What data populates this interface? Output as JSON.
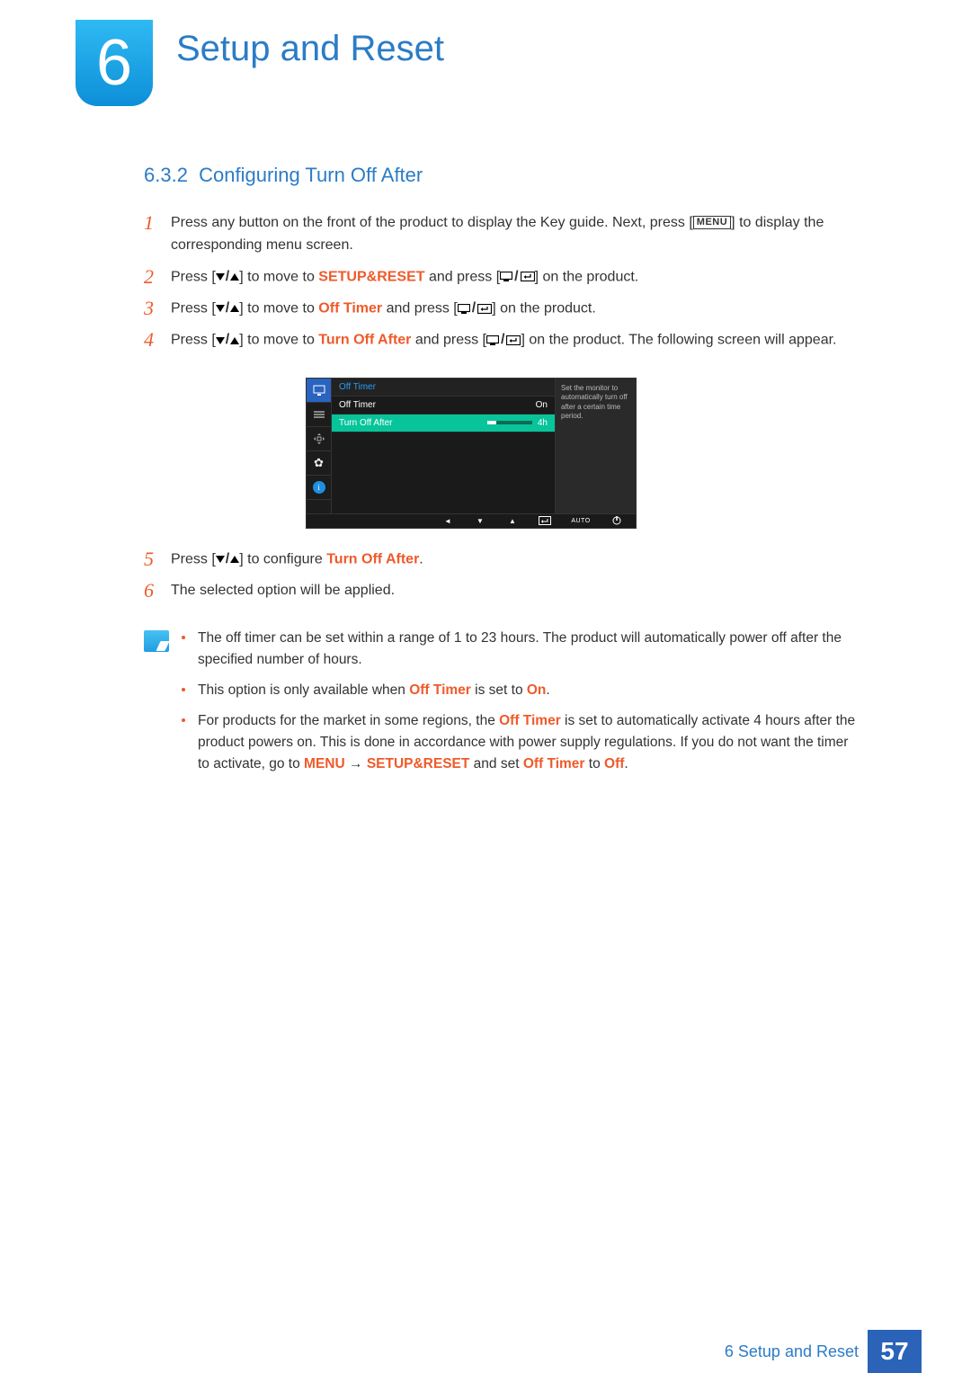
{
  "chapter": {
    "number": "6",
    "title": "Setup and Reset"
  },
  "section": {
    "number": "6.3.2",
    "title": "Configuring Turn Off After"
  },
  "menu_button_label": "MENU",
  "steps": {
    "s1": {
      "num": "1",
      "a": "Press any button on the front of the product to display the Key guide. Next, press [",
      "b": "] to display the corresponding menu screen."
    },
    "s2": {
      "num": "2",
      "a": "Press [",
      "b": "] to move to ",
      "hl": "SETUP&RESET",
      "c": " and press [",
      "d": "] on the product."
    },
    "s3": {
      "num": "3",
      "a": "Press [",
      "b": "] to move to ",
      "hl": "Off Timer",
      "c": " and press [",
      "d": "] on the product."
    },
    "s4": {
      "num": "4",
      "a": "Press [",
      "b": "] to move to ",
      "hl": "Turn Off After",
      "c": " and press [",
      "d": "] on the product. The following screen will appear."
    },
    "s5": {
      "num": "5",
      "a": "Press [",
      "b": "] to configure ",
      "hl": "Turn Off After",
      "c": "."
    },
    "s6": {
      "num": "6",
      "a": "The selected option will be applied."
    }
  },
  "osd": {
    "header": "Off Timer",
    "row1_label": "Off Timer",
    "row1_value": "On",
    "row2_label": "Turn Off After",
    "row2_value": "4h",
    "side_text": "Set the monitor to automatically turn off after a certain time period.",
    "footer_auto": "AUTO"
  },
  "notes": {
    "n1": "The off timer can be set within a range of 1 to 23 hours. The product will automatically power off after the specified number of hours.",
    "n2_a": "This option is only available when ",
    "n2_hl1": "Off Timer",
    "n2_b": " is set to ",
    "n2_hl2": "On",
    "n2_c": ".",
    "n3_a": "For products for the market in some regions, the ",
    "n3_hl1": "Off Timer",
    "n3_b": " is set to automatically activate 4 hours after the product powers on. This is done in accordance with power supply regulations. If you do not want the timer to activate, go to ",
    "n3_hl2": "MENU",
    "n3_arrow": " → ",
    "n3_hl3": "SETUP&RESET",
    "n3_c": " and set ",
    "n3_hl4": "Off Timer",
    "n3_d": " to ",
    "n3_hl5": "Off",
    "n3_e": "."
  },
  "footer": {
    "label": "6 Setup and Reset",
    "page": "57"
  }
}
